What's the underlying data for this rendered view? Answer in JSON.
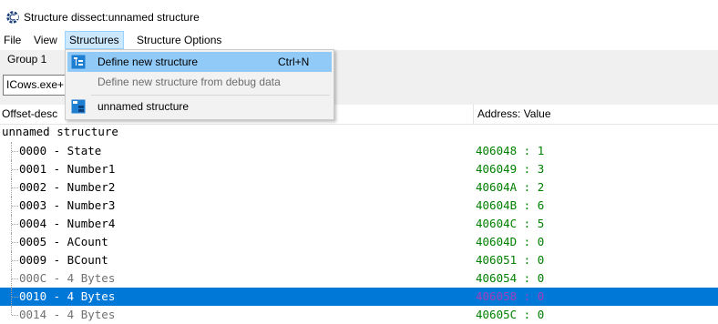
{
  "window": {
    "title": "Structure dissect:unnamed structure",
    "icon": "cheat-engine-gear-icon"
  },
  "menubar": {
    "items": [
      "File",
      "View",
      "Structures",
      "Structure Options"
    ],
    "active": "Structures"
  },
  "toolbar": {
    "group_label": "Group 1",
    "address_value": "ICows.exe+"
  },
  "columns": {
    "offset_description": "Offset-desc",
    "address_value": "Address: Value"
  },
  "structure": {
    "root_name": "unnamed structure",
    "rows": [
      {
        "offset_desc": "0000 - State",
        "value": "406048 : 1",
        "state": "normal"
      },
      {
        "offset_desc": "0001 - Number1",
        "value": "406049 : 3",
        "state": "normal"
      },
      {
        "offset_desc": "0002 - Number2",
        "value": "40604A : 2",
        "state": "normal"
      },
      {
        "offset_desc": "0003 - Number3",
        "value": "40604B : 6",
        "state": "normal"
      },
      {
        "offset_desc": "0004 - Number4",
        "value": "40604C : 5",
        "state": "normal"
      },
      {
        "offset_desc": "0005 - ACount",
        "value": "40604D : 0",
        "state": "normal"
      },
      {
        "offset_desc": "0009 - BCount",
        "value": "406051 : 0",
        "state": "normal"
      },
      {
        "offset_desc": "000C - 4 Bytes",
        "value": "406054 : 0",
        "state": "dim"
      },
      {
        "offset_desc": "0010 - 4 Bytes",
        "value": "406058 : 0",
        "state": "selected"
      },
      {
        "offset_desc": "0014 - 4 Bytes",
        "value": "40605C : 0",
        "state": "dim"
      }
    ]
  },
  "dropdown": {
    "items": [
      {
        "label": "Define new structure",
        "shortcut": "Ctrl+N",
        "icon": "define-structure-icon",
        "enabled": true,
        "highlighted": true
      },
      {
        "label": "Define new structure from debug data",
        "shortcut": "",
        "icon": "",
        "enabled": false,
        "highlighted": false
      },
      {
        "label": "unnamed structure",
        "shortcut": "",
        "icon": "structure-icon",
        "enabled": true,
        "highlighted": false
      }
    ]
  },
  "colors": {
    "selection": "#0078d7",
    "menu_highlight": "#91c9f7",
    "value_text": "#008000",
    "selected_value_text": "#a43fbe"
  }
}
